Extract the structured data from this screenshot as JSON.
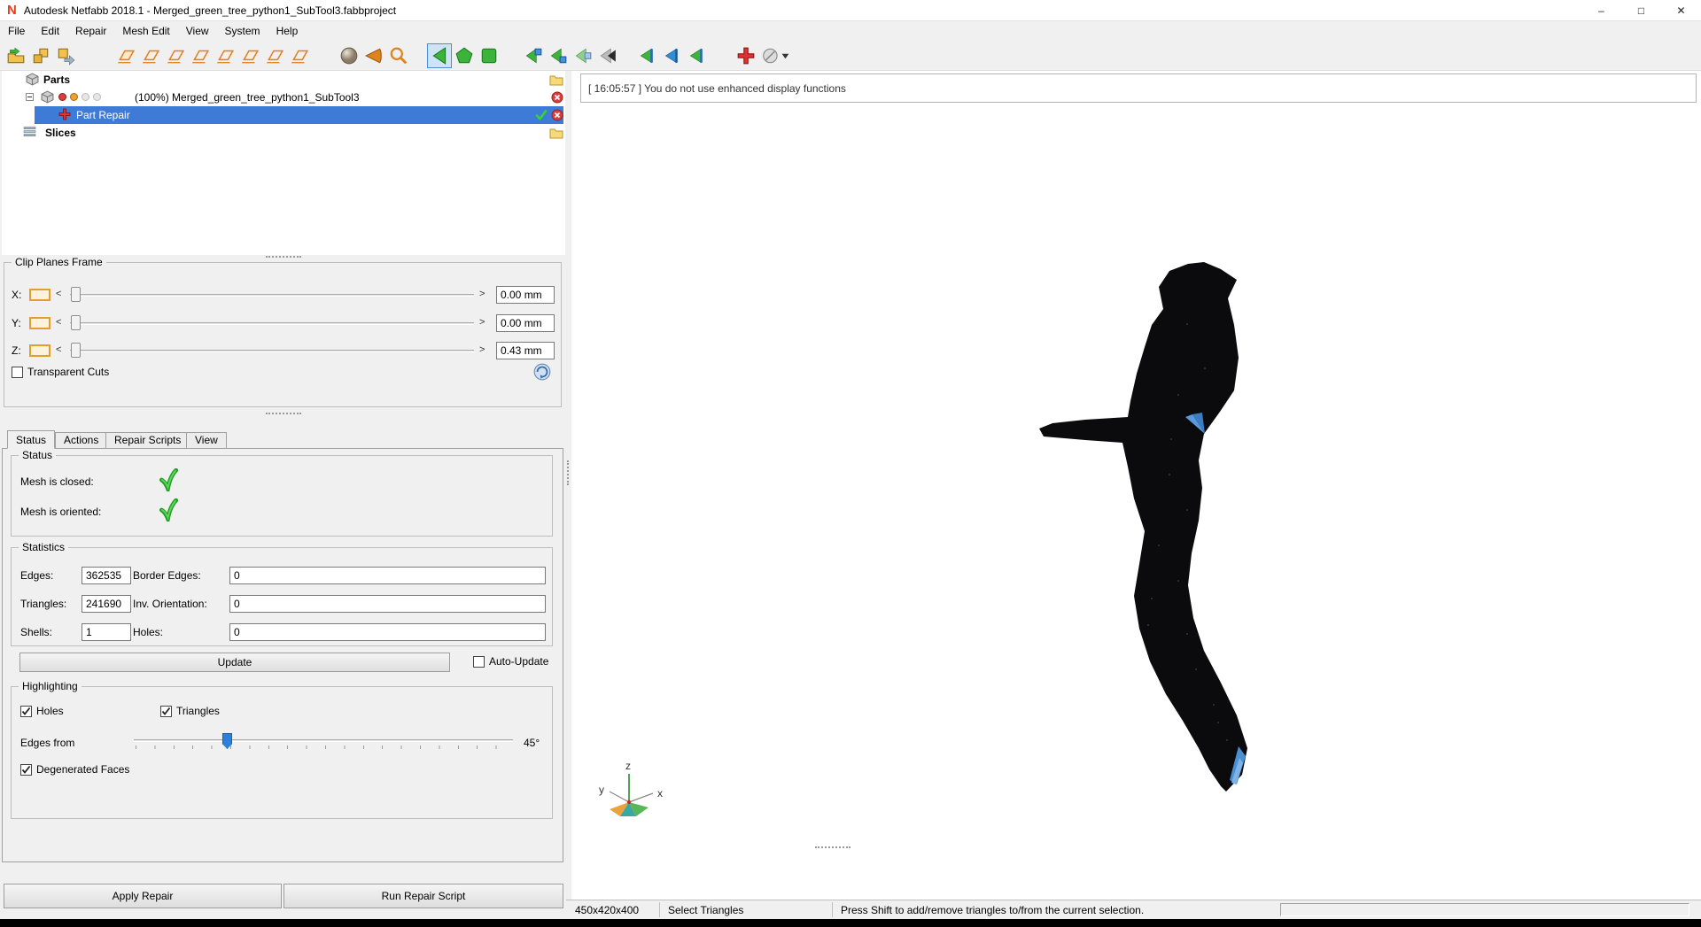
{
  "colors": {
    "selection_blue": "#3d7bd7",
    "toolbar_selected": "#cde4f7",
    "check_green": "#2ab52a",
    "error_red": "#d84040",
    "accent_orange": "#e0821e",
    "tool_green": "#3cb43c"
  },
  "icons": {
    "app-icon": "red N monogram",
    "open-project-icon": "yellow folder with green arrow",
    "add-part-icon": "two yellow boxes",
    "export-part-icon": "yellow box with blue arrow",
    "platform-icon": "orange slanted tray outline",
    "shading-sphere-icon": "shaded gray sphere",
    "cone-left-icon": "orange cone pointing left",
    "zoom-icon": "orange magnifier",
    "select-triangle-icon": "green triangle pointing left, active",
    "pentagon-icon": "green pentagon",
    "cube-icon": "green cube",
    "zoom-part-icon": "green arrow with blue cube",
    "view-direction-icon": "green triangle with blue edge",
    "repair-icon": "red cross",
    "shader-mode-icon": "gray sphere with dropdown arrow",
    "folder-icon": "yellow folder",
    "remove-icon": "red circle with white x",
    "check-icon": "green checkmark",
    "slices-icon": "stacked horizontal lines",
    "mesh-cube-icon": "gray cube",
    "part-repair-icon": "red cross marker",
    "reset-view-icon": "blue sphere with rotation arrow"
  },
  "window": {
    "title": "Autodesk Netfabb 2018.1 - Merged_green_tree_python1_SubTool3.fabbproject",
    "minimize": "–",
    "maximize": "□",
    "close": "✕"
  },
  "menu": {
    "items": [
      "File",
      "Edit",
      "Repair",
      "Mesh Edit",
      "View",
      "System",
      "Help"
    ]
  },
  "tree": {
    "parts_label": "Parts",
    "part_label": "(100%) Merged_green_tree_python1_SubTool3",
    "part_repair_label": "Part Repair",
    "slices_label": "Slices"
  },
  "clip": {
    "title": "Clip Planes Frame",
    "x_label": "X:",
    "y_label": "Y:",
    "z_label": "Z:",
    "x_value": "0.00 mm",
    "y_value": "0.00 mm",
    "z_value": "0.43 mm",
    "dec_label": "<",
    "inc_label": ">",
    "transparent_cuts_label": "Transparent Cuts"
  },
  "tabs": {
    "items": [
      "Status",
      "Actions",
      "Repair Scripts",
      "View"
    ],
    "active": "Status"
  },
  "status": {
    "title": "Status",
    "closed_label": "Mesh is closed:",
    "oriented_label": "Mesh is oriented:"
  },
  "stats": {
    "title": "Statistics",
    "edges_label": "Edges:",
    "edges_value": "362535",
    "border_edges_label": "Border Edges:",
    "border_edges_value": "0",
    "triangles_label": "Triangles:",
    "triangles_value": "241690",
    "inv_orientation_label": "Inv. Orientation:",
    "inv_orientation_value": "0",
    "shells_label": "Shells:",
    "shells_value": "1",
    "holes_label": "Holes:",
    "holes_value": "0",
    "update_label": "Update",
    "auto_update_label": "Auto-Update"
  },
  "highlight": {
    "title": "Highlighting",
    "holes_label": "Holes",
    "triangles_label": "Triangles",
    "edges_from_label": "Edges from",
    "angle_value": "45°",
    "degenerated_label": "Degenerated Faces"
  },
  "actions": {
    "apply_label": "Apply Repair",
    "run_label": "Run Repair Script"
  },
  "viewport": {
    "log_message": "[ 16:05:57 ] You do not use enhanced display functions",
    "axes": {
      "x": "x",
      "y": "y",
      "z": "z"
    }
  },
  "statusbar": {
    "dimensions": "450x420x400",
    "mode": "Select Triangles",
    "hint": "Press Shift to add/remove triangles to/from the current selection."
  }
}
